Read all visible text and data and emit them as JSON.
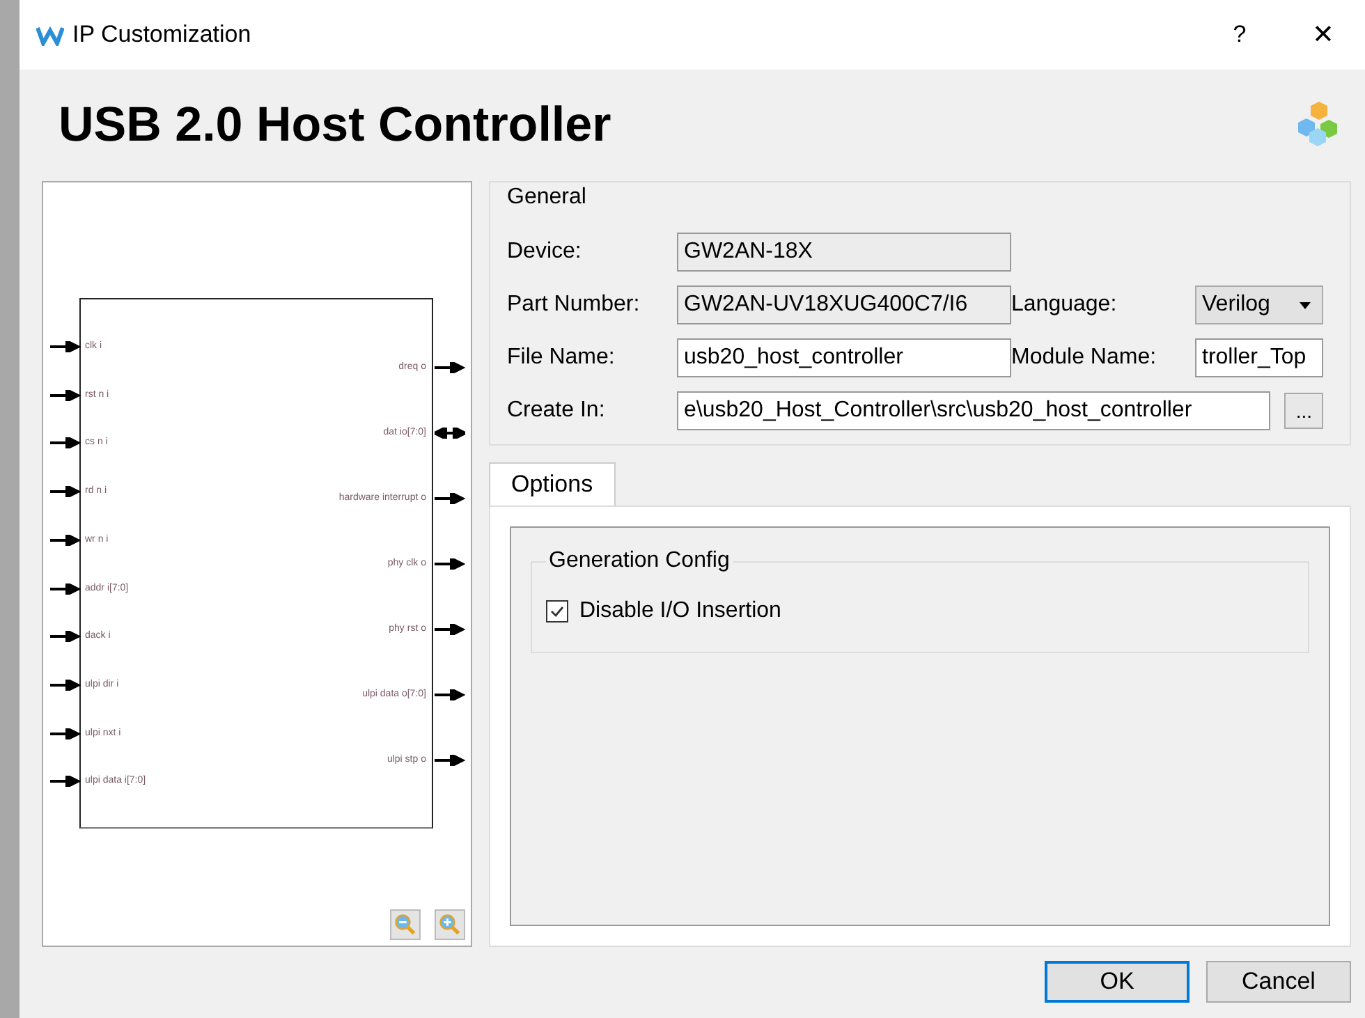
{
  "window": {
    "title": "IP Customization",
    "help": "?",
    "close": "✕"
  },
  "heading": "USB 2.0 Host Controller",
  "diagram": {
    "inputs": [
      {
        "label": "clk i",
        "kind": "in"
      },
      {
        "label": "rst n i",
        "kind": "in"
      },
      {
        "label": "cs n i",
        "kind": "in"
      },
      {
        "label": "rd n i",
        "kind": "in"
      },
      {
        "label": "wr n i",
        "kind": "in"
      },
      {
        "label": "addr i[7:0]",
        "kind": "in"
      },
      {
        "label": "dack i",
        "kind": "in"
      },
      {
        "label": "ulpi dir i",
        "kind": "in"
      },
      {
        "label": "ulpi nxt i",
        "kind": "in"
      },
      {
        "label": "ulpi data i[7:0]",
        "kind": "in"
      }
    ],
    "outputs": [
      {
        "label": "dreq o",
        "kind": "out"
      },
      {
        "label": "dat io[7:0]",
        "kind": "inout"
      },
      {
        "label": "hardware interrupt o",
        "kind": "out"
      },
      {
        "label": "phy clk o",
        "kind": "out"
      },
      {
        "label": "phy rst o",
        "kind": "out"
      },
      {
        "label": "ulpi data o[7:0]",
        "kind": "out"
      },
      {
        "label": "ulpi stp o",
        "kind": "out"
      }
    ]
  },
  "general": {
    "title": "General",
    "device_label": "Device:",
    "device": "GW2AN-18X",
    "part_label": "Part Number:",
    "part": "GW2AN-UV18XUG400C7/I6",
    "language_label": "Language:",
    "language": "Verilog",
    "file_label": "File Name:",
    "file": "usb20_host_controller",
    "module_label": "Module Name:",
    "module": "troller_Top",
    "create_label": "Create In:",
    "create": "e\\usb20_Host_Controller\\src\\usb20_host_controller",
    "browse": "..."
  },
  "tabs": [
    {
      "label": "Options",
      "selected": true
    }
  ],
  "config": {
    "title": "Generation Config",
    "options": [
      {
        "label": "Disable I/O Insertion",
        "checked": true
      }
    ]
  },
  "buttons": [
    {
      "label": "OK",
      "kind": "default"
    },
    {
      "label": "Cancel",
      "kind": "normal"
    }
  ]
}
